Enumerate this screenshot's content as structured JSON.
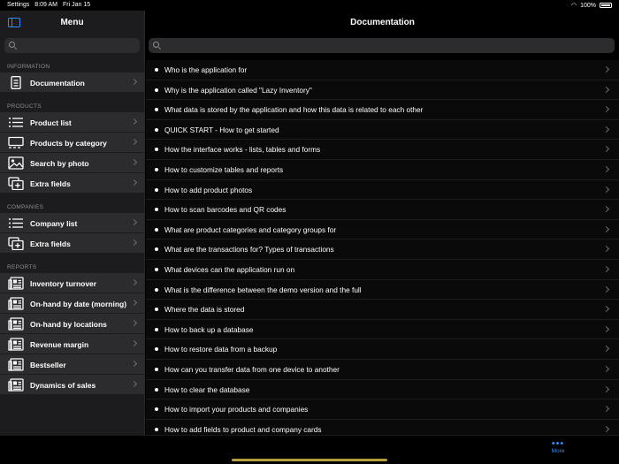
{
  "status": {
    "app": "Settings",
    "time": "8:09 AM",
    "date": "Fri Jan 15",
    "battery": "100%"
  },
  "sidebar": {
    "title": "Menu",
    "search_placeholder": "",
    "sections": [
      {
        "label": "INFORMATION",
        "items": [
          {
            "label": "Documentation",
            "icon": "document-icon"
          }
        ]
      },
      {
        "label": "PRODUCTS",
        "items": [
          {
            "label": "Product list",
            "icon": "list-icon"
          },
          {
            "label": "Products by category",
            "icon": "category-icon"
          },
          {
            "label": "Search by photo",
            "icon": "photo-icon"
          },
          {
            "label": "Extra fields",
            "icon": "add-fields-icon"
          }
        ]
      },
      {
        "label": "COMPANIES",
        "items": [
          {
            "label": "Company list",
            "icon": "list-icon"
          },
          {
            "label": "Extra fields",
            "icon": "add-fields-icon"
          }
        ]
      },
      {
        "label": "REPORTS",
        "items": [
          {
            "label": "Inventory turnover",
            "icon": "report-icon"
          },
          {
            "label": "On-hand by date (morning)",
            "icon": "report-icon"
          },
          {
            "label": "On-hand by locations",
            "icon": "report-icon"
          },
          {
            "label": "Revenue margin",
            "icon": "report-icon"
          },
          {
            "label": "Bestseller",
            "icon": "report-icon"
          },
          {
            "label": "Dynamics of sales",
            "icon": "report-icon"
          }
        ]
      }
    ]
  },
  "main": {
    "title": "Documentation",
    "search_placeholder": "",
    "items": [
      "Who is the application for",
      "Why is the application called \"Lazy Inventory\"",
      "What data is stored by the application and how this data is related to each other",
      "QUICK START - How to get started",
      "How the interface works - lists, tables and forms",
      "How to customize tables and reports",
      "How to add product photos",
      "How to scan barcodes and QR codes",
      "What are product categories and category groups for",
      "What are the transactions for? Types of transactions",
      "What devices can the application run on",
      "What is the difference between the demo version and the full",
      "Where the data is stored",
      "How to back up a database",
      "How to restore data from a backup",
      "How can you transfer data from one device to another",
      "How to clear the database",
      "How to import your products and companies",
      "How to add fields to product and company cards"
    ]
  },
  "bottom": {
    "more_label": "More"
  },
  "colors": {
    "accent": "#2f8cff",
    "sidebar_bg": "#1c1c1e",
    "item_bg": "#2c2c2e",
    "section": "#8e8e93"
  }
}
